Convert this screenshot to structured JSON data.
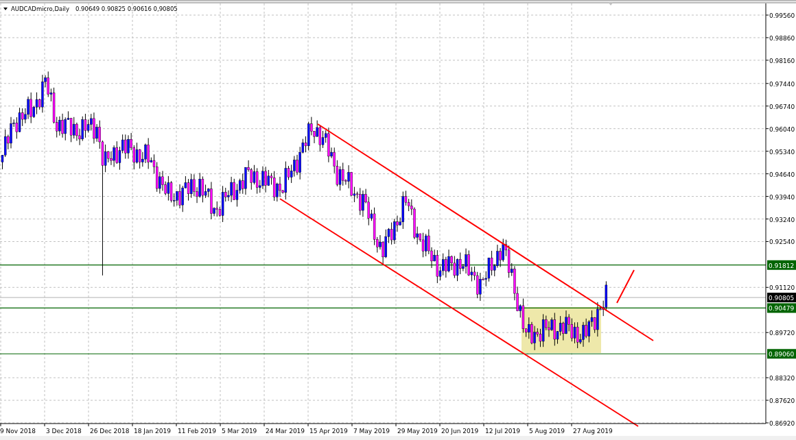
{
  "header": {
    "symbol": "AUDCADmicro,Daily",
    "ohlc": "0.90649 0.90825 0.90616 0,90805"
  },
  "price_axis": [
    "0.99560",
    "0.98860",
    "0.98160",
    "0.97440",
    "0.96740",
    "0.96040",
    "0.95340",
    "0.94640",
    "0.93940",
    "0.93240",
    "0.92540",
    "0.91120",
    "0.89720",
    "0.88320",
    "0.87620",
    "0.86920"
  ],
  "price_tags": [
    {
      "label": "0.91812",
      "kind": "level"
    },
    {
      "label": "0.90805",
      "kind": "current"
    },
    {
      "label": "0.90479",
      "kind": "level"
    },
    {
      "label": "0.89060",
      "kind": "level"
    }
  ],
  "time_axis": [
    "9 Nov 2018",
    "3 Dec 2018",
    "26 Dec 2018",
    "18 Jan 2019",
    "11 Feb 2019",
    "5 Mar 2019",
    "24 Mar 2019",
    "15 Apr 2019",
    "7 May 2019",
    "29 May 2019",
    "20 Jun 2019",
    "12 Jul 2019",
    "5 Aug 2019",
    "27 Aug 2019"
  ]
}
